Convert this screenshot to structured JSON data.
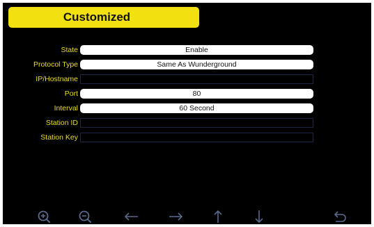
{
  "header": {
    "title": "Customized"
  },
  "form": {
    "rows": [
      {
        "label": "State",
        "value": "Enable",
        "style": "filled"
      },
      {
        "label": "Protocol Type",
        "value": "Same As Wunderground",
        "style": "filled"
      },
      {
        "label": "IP/Hostname",
        "value": "",
        "style": "empty"
      },
      {
        "label": "Port",
        "value": "80",
        "style": "filled"
      },
      {
        "label": "Interval",
        "value": "60 Second",
        "style": "filled"
      },
      {
        "label": "Station ID",
        "value": "",
        "style": "empty"
      },
      {
        "label": "Station Key",
        "value": "",
        "style": "empty"
      }
    ]
  },
  "toolbar": {
    "icons": [
      "zoom-in-icon",
      "zoom-out-icon",
      "arrow-left-icon",
      "arrow-right-icon",
      "arrow-up-icon",
      "arrow-down-icon",
      "back-icon"
    ],
    "icon_color": "#5a6a8c"
  },
  "colors": {
    "background": "#000000",
    "accent": "#f2e010",
    "label": "#ecdd22",
    "field_fill": "#ffffff",
    "field_empty_border": "#1d2440"
  }
}
